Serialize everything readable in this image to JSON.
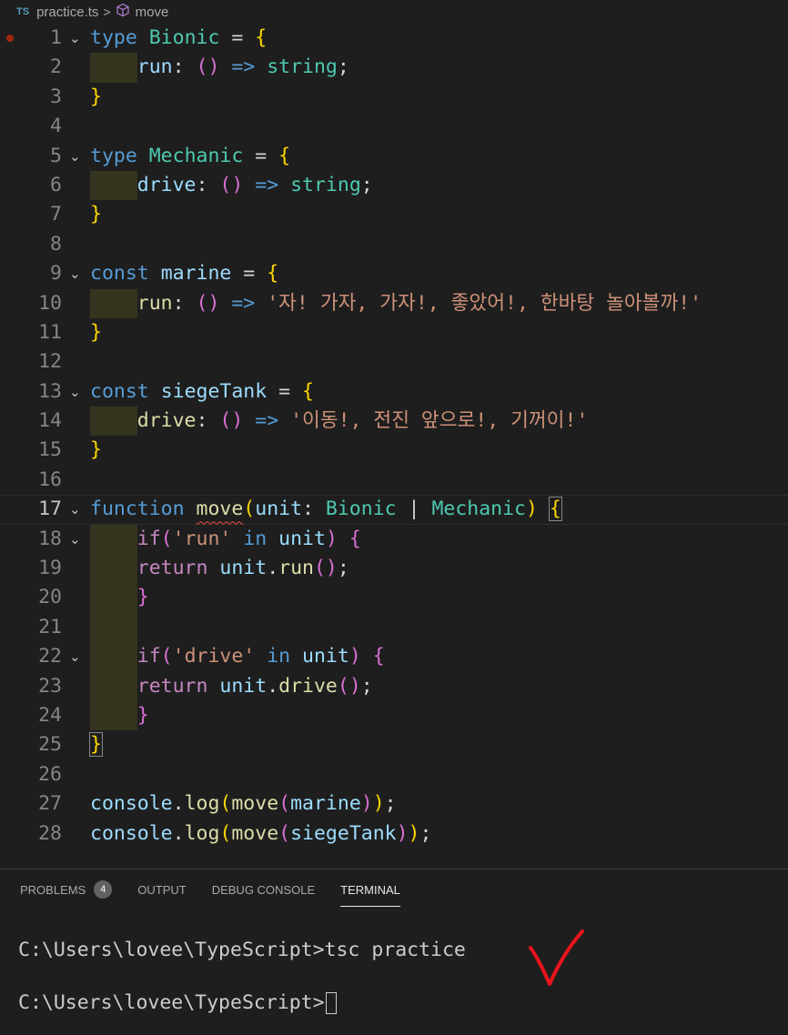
{
  "breadcrumb": {
    "file_icon": "TS",
    "file": "practice.ts",
    "separator": ">",
    "symbol_icon": "cube-icon",
    "symbol": "move"
  },
  "editor": {
    "lines": [
      {
        "n": "1",
        "fold": true,
        "breakpoint": true,
        "tokens": [
          [
            "kw",
            "type"
          ],
          [
            "pn",
            " "
          ],
          [
            "type",
            "Bionic"
          ],
          [
            "pn",
            " = "
          ],
          [
            "b1",
            "{"
          ]
        ]
      },
      {
        "n": "2",
        "indent": 1,
        "tokens": [
          [
            "var",
            "run"
          ],
          [
            "pn",
            ": "
          ],
          [
            "b2",
            "()"
          ],
          [
            "pn",
            " "
          ],
          [
            "kw",
            "=>"
          ],
          [
            "pn",
            " "
          ],
          [
            "type",
            "string"
          ],
          [
            "pn",
            ";"
          ]
        ]
      },
      {
        "n": "3",
        "tokens": [
          [
            "b1",
            "}"
          ]
        ]
      },
      {
        "n": "4",
        "tokens": []
      },
      {
        "n": "5",
        "fold": true,
        "tokens": [
          [
            "kw",
            "type"
          ],
          [
            "pn",
            " "
          ],
          [
            "type",
            "Mechanic"
          ],
          [
            "pn",
            " = "
          ],
          [
            "b1",
            "{"
          ]
        ]
      },
      {
        "n": "6",
        "indent": 1,
        "tokens": [
          [
            "var",
            "drive"
          ],
          [
            "pn",
            ": "
          ],
          [
            "b2",
            "()"
          ],
          [
            "pn",
            " "
          ],
          [
            "kw",
            "=>"
          ],
          [
            "pn",
            " "
          ],
          [
            "type",
            "string"
          ],
          [
            "pn",
            ";"
          ]
        ]
      },
      {
        "n": "7",
        "tokens": [
          [
            "b1",
            "}"
          ]
        ]
      },
      {
        "n": "8",
        "tokens": []
      },
      {
        "n": "9",
        "fold": true,
        "tokens": [
          [
            "kw",
            "const"
          ],
          [
            "pn",
            " "
          ],
          [
            "var",
            "marine"
          ],
          [
            "pn",
            " = "
          ],
          [
            "b1",
            "{"
          ]
        ]
      },
      {
        "n": "10",
        "indent": 1,
        "tokens": [
          [
            "fn",
            "run"
          ],
          [
            "pn",
            ": "
          ],
          [
            "b2",
            "()"
          ],
          [
            "pn",
            " "
          ],
          [
            "kw",
            "=>"
          ],
          [
            "pn",
            " "
          ],
          [
            "str",
            "'자! 가자, 가자!, 좋았어!, 한바탕 놀아볼까!'"
          ]
        ]
      },
      {
        "n": "11",
        "tokens": [
          [
            "b1",
            "}"
          ]
        ]
      },
      {
        "n": "12",
        "tokens": []
      },
      {
        "n": "13",
        "fold": true,
        "tokens": [
          [
            "kw",
            "const"
          ],
          [
            "pn",
            " "
          ],
          [
            "var",
            "siegeTank"
          ],
          [
            "pn",
            " = "
          ],
          [
            "b1",
            "{"
          ]
        ]
      },
      {
        "n": "14",
        "indent": 1,
        "tokens": [
          [
            "fn",
            "drive"
          ],
          [
            "pn",
            ": "
          ],
          [
            "b2",
            "()"
          ],
          [
            "pn",
            " "
          ],
          [
            "kw",
            "=>"
          ],
          [
            "pn",
            " "
          ],
          [
            "str",
            "'이동!, 전진 앞으로!, 기꺼이!'"
          ]
        ]
      },
      {
        "n": "15",
        "tokens": [
          [
            "b1",
            "}"
          ]
        ]
      },
      {
        "n": "16",
        "tokens": []
      },
      {
        "n": "17",
        "fold": true,
        "active": true,
        "tokens": [
          [
            "kw",
            "function"
          ],
          [
            "pn",
            " "
          ],
          [
            "fn sq",
            "move"
          ],
          [
            "b1",
            "("
          ],
          [
            "var",
            "unit"
          ],
          [
            "pn",
            ": "
          ],
          [
            "type",
            "Bionic"
          ],
          [
            "pn",
            " | "
          ],
          [
            "type",
            "Mechanic"
          ],
          [
            "b1",
            ")"
          ],
          [
            "pn",
            " "
          ],
          [
            "b1 box",
            "{"
          ]
        ]
      },
      {
        "n": "18",
        "fold": true,
        "indent": 1,
        "tokens": [
          [
            "ctl",
            "if"
          ],
          [
            "b2",
            "("
          ],
          [
            "str",
            "'run'"
          ],
          [
            "pn",
            " "
          ],
          [
            "kw",
            "in"
          ],
          [
            "pn",
            " "
          ],
          [
            "var",
            "unit"
          ],
          [
            "b2",
            ")"
          ],
          [
            "pn",
            " "
          ],
          [
            "b2",
            "{"
          ]
        ]
      },
      {
        "n": "19",
        "indent": 1,
        "tokens": [
          [
            "ctl",
            "return"
          ],
          [
            "pn",
            " "
          ],
          [
            "var",
            "unit"
          ],
          [
            "pn",
            "."
          ],
          [
            "fn",
            "run"
          ],
          [
            "b2",
            "()"
          ],
          [
            "pn",
            ";"
          ]
        ]
      },
      {
        "n": "20",
        "indent": 1,
        "tokens": [
          [
            "b2",
            "}"
          ]
        ]
      },
      {
        "n": "21",
        "guide": true,
        "tokens": []
      },
      {
        "n": "22",
        "fold": true,
        "indent": 1,
        "tokens": [
          [
            "ctl",
            "if"
          ],
          [
            "b2",
            "("
          ],
          [
            "str",
            "'drive'"
          ],
          [
            "pn",
            " "
          ],
          [
            "kw",
            "in"
          ],
          [
            "pn",
            " "
          ],
          [
            "var",
            "unit"
          ],
          [
            "b2",
            ")"
          ],
          [
            "pn",
            " "
          ],
          [
            "b2",
            "{"
          ]
        ]
      },
      {
        "n": "23",
        "indent": 1,
        "tokens": [
          [
            "ctl",
            "return"
          ],
          [
            "pn",
            " "
          ],
          [
            "var",
            "unit"
          ],
          [
            "pn",
            "."
          ],
          [
            "fn",
            "drive"
          ],
          [
            "b2",
            "()"
          ],
          [
            "pn",
            ";"
          ]
        ]
      },
      {
        "n": "24",
        "indent": 1,
        "tokens": [
          [
            "b2",
            "}"
          ]
        ]
      },
      {
        "n": "25",
        "tokens": [
          [
            "b1 box",
            "}"
          ]
        ]
      },
      {
        "n": "26",
        "tokens": []
      },
      {
        "n": "27",
        "tokens": [
          [
            "var",
            "console"
          ],
          [
            "pn",
            "."
          ],
          [
            "fn",
            "log"
          ],
          [
            "b1",
            "("
          ],
          [
            "fn",
            "move"
          ],
          [
            "b2",
            "("
          ],
          [
            "var",
            "marine"
          ],
          [
            "b2",
            ")"
          ],
          [
            "b1",
            ")"
          ],
          [
            "pn",
            ";"
          ]
        ]
      },
      {
        "n": "28",
        "tokens": [
          [
            "var",
            "console"
          ],
          [
            "pn",
            "."
          ],
          [
            "fn",
            "log"
          ],
          [
            "b1",
            "("
          ],
          [
            "fn",
            "move"
          ],
          [
            "b2",
            "("
          ],
          [
            "var",
            "siegeTank"
          ],
          [
            "b2",
            ")"
          ],
          [
            "b1",
            ")"
          ],
          [
            "pn",
            ";"
          ]
        ]
      }
    ]
  },
  "panel": {
    "tabs": [
      {
        "label": "PROBLEMS",
        "badge": "4",
        "active": false
      },
      {
        "label": "OUTPUT",
        "active": false
      },
      {
        "label": "DEBUG CONSOLE",
        "active": false
      },
      {
        "label": "TERMINAL",
        "active": true
      }
    ]
  },
  "terminal": {
    "lines": [
      "C:\\Users\\lovee\\TypeScript>tsc practice",
      "",
      "C:\\Users\\lovee\\TypeScript>"
    ]
  },
  "annotation": {
    "icon": "checkmark-icon",
    "color": "#e8141b"
  }
}
